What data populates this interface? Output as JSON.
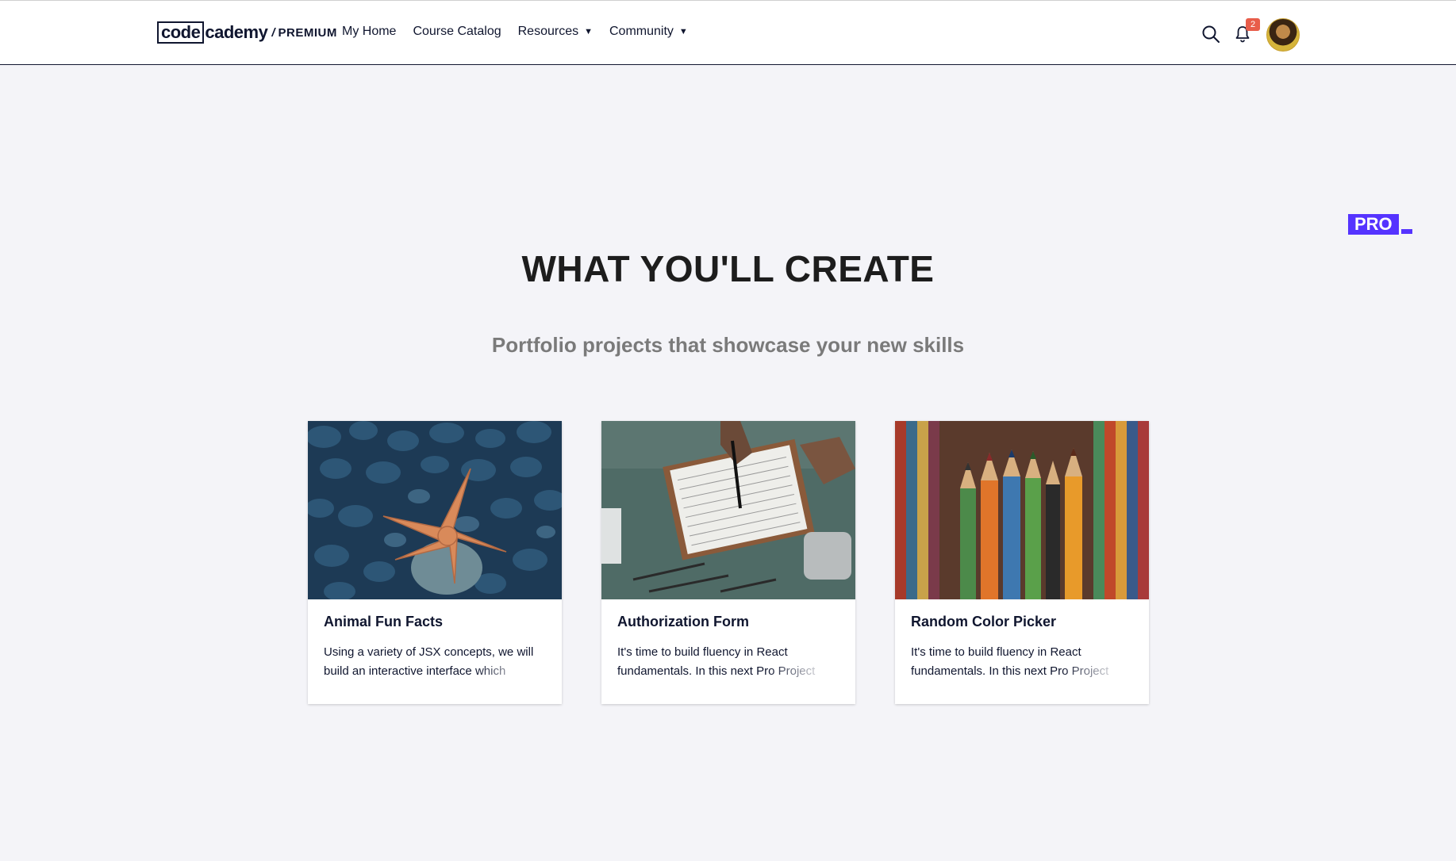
{
  "nav": {
    "logo_code": "code",
    "logo_cademy": "cademy",
    "logo_sep": "/",
    "logo_premium": "PREMIUM",
    "links": [
      {
        "label": "My Home"
      },
      {
        "label": "Course Catalog"
      },
      {
        "label": "Resources",
        "has_dropdown": true
      },
      {
        "label": "Community",
        "has_dropdown": true
      }
    ],
    "notification_count": "2",
    "icons": [
      "search-icon",
      "bell-icon",
      "avatar"
    ]
  },
  "pro_badge": "PRO",
  "hero": {
    "title": "WHAT YOU'LL CREATE",
    "subtitle": "Portfolio projects that showcase your new skills"
  },
  "cards": [
    {
      "title": "Animal Fun Facts",
      "description": "Using a variety of JSX concepts, we will build an interactive interface which displays fun facts",
      "image": "starfish-on-pebbles"
    },
    {
      "title": "Authorization Form",
      "description": "It's time to build fluency in React fundamentals. In this next Pro Project",
      "image": "hand-writing-on-clipboard"
    },
    {
      "title": "Random Color Picker",
      "description": "It's time to build fluency in React fundamentals. In this next Pro Project",
      "image": "colored-pencils"
    }
  ],
  "colors": {
    "brand_dark": "#10162f",
    "pro_purple": "#5533ff",
    "badge_red": "#e85d4a",
    "page_bg": "#f4f4f8"
  }
}
